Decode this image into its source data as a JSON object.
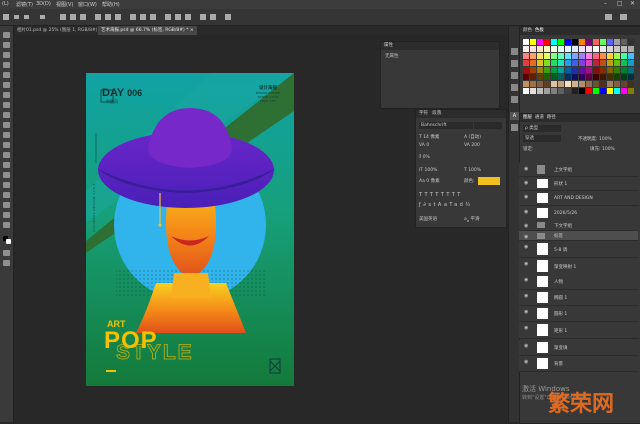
{
  "menu": [
    "(L)",
    "滤镜(T)",
    "3D(D)",
    "视图(V)",
    "窗口(W)",
    "帮助(H)"
  ],
  "tabs": [
    {
      "label": "相片01.psd @ 25% (图层 1, RGB/8#) *",
      "active": false
    },
    {
      "label": "艺术海报.psd @ 66.7% (标签, RGB/8#) *",
      "active": true
    }
  ],
  "poster": {
    "day": "DAY",
    "day_number": "006",
    "day_sub": "中国风",
    "top_right_lines": [
      "设计海报",
      "DESIGN POSTER",
      "SIMPLE STYLE",
      "ENJOY LIFE"
    ],
    "vertical_text": "COLORFUL DESIGN STYLE",
    "art": "ART",
    "pop": "POP",
    "style": "STYLE",
    "colors": {
      "pop_yellow": "#f5c000",
      "hat_purple": "#5b22c8",
      "circle_blue": "#31b4ec",
      "wedge_green": "#2e7034"
    }
  },
  "properties_panel": {
    "title": "属性",
    "empty_label": "无属性"
  },
  "character_panel": {
    "tabs": [
      "字符",
      "段落"
    ],
    "font": "Bahnschrift",
    "size": "14 像素",
    "leading": "(自动)",
    "kerning": "0",
    "tracking": "200",
    "scale_label": "0%",
    "vert_scale": "100%",
    "horiz_scale": "100%",
    "baseline": "0 像素",
    "color_label": "颜色:",
    "color": "#f0c020",
    "language": "美国英语",
    "aa": "平滑"
  },
  "swatches_panel": {
    "tabs": [
      "颜色",
      "色板"
    ]
  },
  "layers_panel": {
    "tabs": [
      "图层",
      "通道",
      "路径"
    ],
    "kind": "类型",
    "blend": "穿透",
    "opacity_label": "不透明度:",
    "opacity": "100%",
    "lock_label": "锁定:",
    "fill_label": "填充:",
    "fill": "100%",
    "layers": [
      {
        "name": "上文字组"
      },
      {
        "name": "形状 1"
      },
      {
        "name": "ART AND DESIGN"
      },
      {
        "name": "2026/5/26"
      },
      {
        "name": "下文字组"
      },
      {
        "name": "标签"
      },
      {
        "name": "5-8 调"
      },
      {
        "name": "渐变映射 1"
      },
      {
        "name": "人物"
      },
      {
        "name": "椭圆 1"
      },
      {
        "name": "圆形 1"
      },
      {
        "name": "矩形 1"
      },
      {
        "name": "渐变填"
      },
      {
        "name": "背景"
      }
    ]
  },
  "watermark": {
    "activate": "激活 Windows",
    "activate_sub": "转到\"设置\"以激活 Windows。",
    "brand": "繁荣网"
  }
}
